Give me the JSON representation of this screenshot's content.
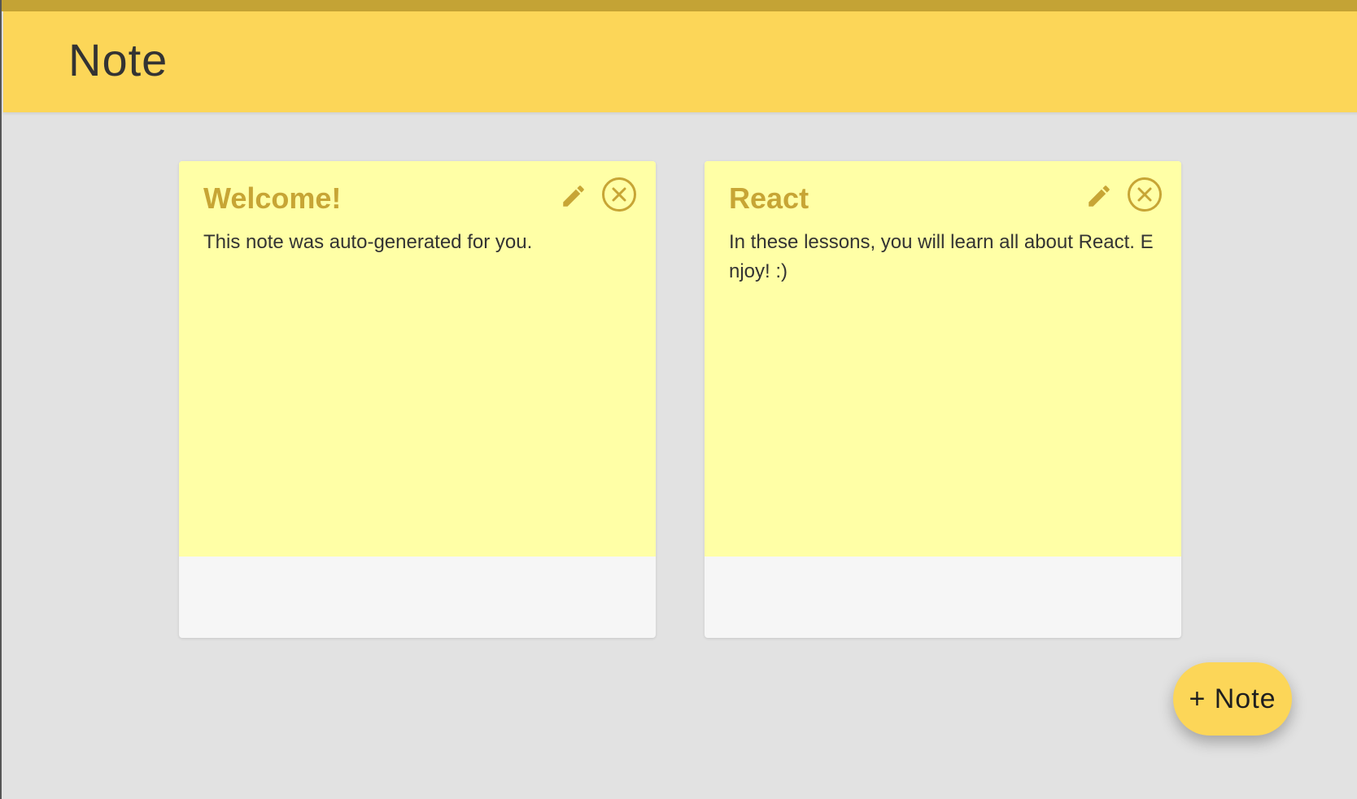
{
  "header": {
    "title": "Note"
  },
  "colors": {
    "header_bg": "#fcd658",
    "header_strip": "#c4a335",
    "note_bg": "#ffffa6",
    "accent": "#c7a535"
  },
  "notes": [
    {
      "title": "Welcome!",
      "text": "This note was auto-generated for you.",
      "edit_icon": "pencil-icon",
      "delete_icon": "close-circle-icon"
    },
    {
      "title": "React",
      "text": "In these lessons, you will learn all about React. Enjoy! :)",
      "edit_icon": "pencil-icon",
      "delete_icon": "close-circle-icon"
    }
  ],
  "fab": {
    "label": "+ Note"
  }
}
